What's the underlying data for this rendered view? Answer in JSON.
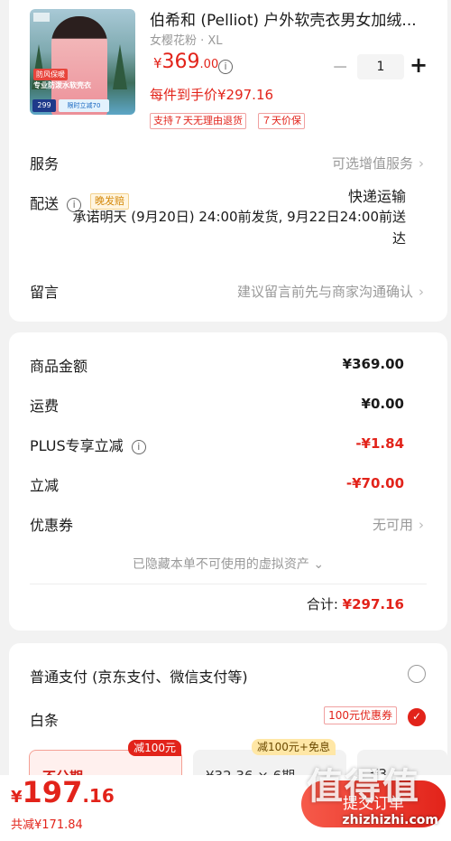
{
  "product": {
    "title": "伯希和 (Pelliot) 户外软壳衣男女加绒...",
    "spec": "女樱花粉 · XL",
    "price_currency": "¥",
    "price_int": "369",
    "price_dec": ".00",
    "each_price": "每件到手价¥297.16",
    "tags": [
      "支持７天无理由退货",
      "７天价保"
    ],
    "quantity": "1",
    "minus": "−",
    "plus": "+",
    "thumb_text1": "防风保暖",
    "thumb_text2": "专业防泼水软壳衣",
    "thumb_price": "299",
    "thumb_chip": "限时立减70"
  },
  "service": {
    "label": "服务",
    "value": "可选增值服务"
  },
  "shipping": {
    "label": "配送",
    "late_tag": "晚发赔",
    "method": "快递运输",
    "promise": "承诺明天 (9月20日) 24:00前发货, 9月22日24:00前送达"
  },
  "message": {
    "label": "留言",
    "value": "建议留言前先与商家沟通确认"
  },
  "summary": {
    "rows": [
      {
        "label": "商品金额",
        "value": "¥369.00"
      },
      {
        "label": "运费",
        "value": "¥0.00"
      },
      {
        "label": "PLUS专享立减",
        "value": "-¥1.84"
      },
      {
        "label": "立减",
        "value": "-¥70.00"
      },
      {
        "label": "优惠券",
        "value": "无可用"
      }
    ],
    "hidden_note": "已隐藏本单不可使用的虚拟资产 ⌄",
    "total_label": "合计: ",
    "total_value": "¥297.16"
  },
  "payment": {
    "option1": "普通支付 (京东支付、微信支付等)",
    "option2": "白条",
    "coupon": "100元优惠券",
    "plans": [
      {
        "badge": "减100元",
        "text": "不分期"
      },
      {
        "badge": "减100元+免息",
        "text": "¥32.36 × 6期"
      },
      {
        "text": "¥3..."
      }
    ]
  },
  "footer": {
    "currency": "¥",
    "price_int": "197",
    "price_dec": ".16",
    "discount": "共减¥171.84",
    "submit": "提交订单"
  },
  "watermark": {
    "text": "值得值",
    "url": "zhizhizhi.com"
  },
  "colors": {
    "accent": "#e2231a",
    "background": "#f2f2f2"
  },
  "icons": [
    "info-icon",
    "chevron-right-icon",
    "radio-icon",
    "check-icon"
  ]
}
